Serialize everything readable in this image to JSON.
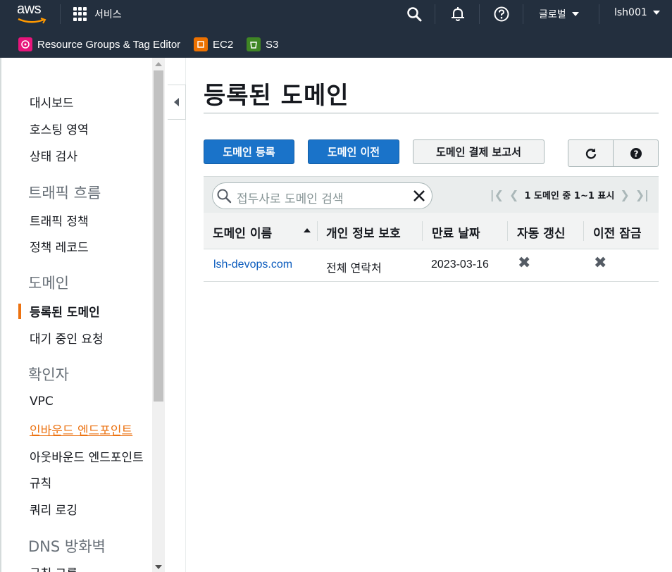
{
  "header": {
    "logo_text": "aws",
    "services_label": "서비스",
    "region_label": "글로벌",
    "user_label": "lsh001",
    "icons": [
      "search-icon",
      "bell-icon",
      "help-icon"
    ]
  },
  "favorites": [
    {
      "label": "Resource Groups & Tag Editor",
      "icon": "resource-groups-icon",
      "color": "#e7157b"
    },
    {
      "label": "EC2",
      "icon": "ec2-icon",
      "color": "#ed7100"
    },
    {
      "label": "S3",
      "icon": "s3-icon",
      "color": "#3f8624"
    }
  ],
  "sidebar": {
    "items": [
      {
        "label": "대시보드",
        "kind": "item"
      },
      {
        "label": "호스팅 영역",
        "kind": "item"
      },
      {
        "label": "상태 검사",
        "kind": "item"
      },
      {
        "label": "트래픽 흐름",
        "kind": "section"
      },
      {
        "label": "트래픽 정책",
        "kind": "item"
      },
      {
        "label": "정책 레코드",
        "kind": "item"
      },
      {
        "label": "도메인",
        "kind": "section"
      },
      {
        "label": "등록된 도메인",
        "kind": "active"
      },
      {
        "label": "대기 중인 요청",
        "kind": "item"
      },
      {
        "label": "확인자",
        "kind": "section"
      },
      {
        "label": "VPC",
        "kind": "item"
      },
      {
        "label": "인바운드 엔드포인트",
        "kind": "link"
      },
      {
        "label": "아웃바운드 엔드포인트",
        "kind": "item"
      },
      {
        "label": "규칙",
        "kind": "item"
      },
      {
        "label": "쿼리 로깅",
        "kind": "item"
      },
      {
        "label": "DNS 방화벽",
        "kind": "section"
      },
      {
        "label": "규칙 그룹",
        "kind": "item"
      }
    ]
  },
  "main": {
    "title": "등록된 도메인",
    "buttons": {
      "register": "도메인 등록",
      "transfer": "도메인 이전",
      "billing_report": "도메인 결제 보고서"
    },
    "search_placeholder": "접두사로 도메인 검색",
    "pagination": "1 도메인 중 1~1 표시",
    "columns": [
      "도메인 이름",
      "개인 정보 보호",
      "만료 날짜",
      "자동 갱신",
      "이전 잠금"
    ],
    "rows": [
      {
        "domain": "lsh-devops.com",
        "privacy": "전체 연락처",
        "expires": "2023-03-16",
        "auto_renew": "✖",
        "transfer_lock": "✖"
      }
    ]
  }
}
